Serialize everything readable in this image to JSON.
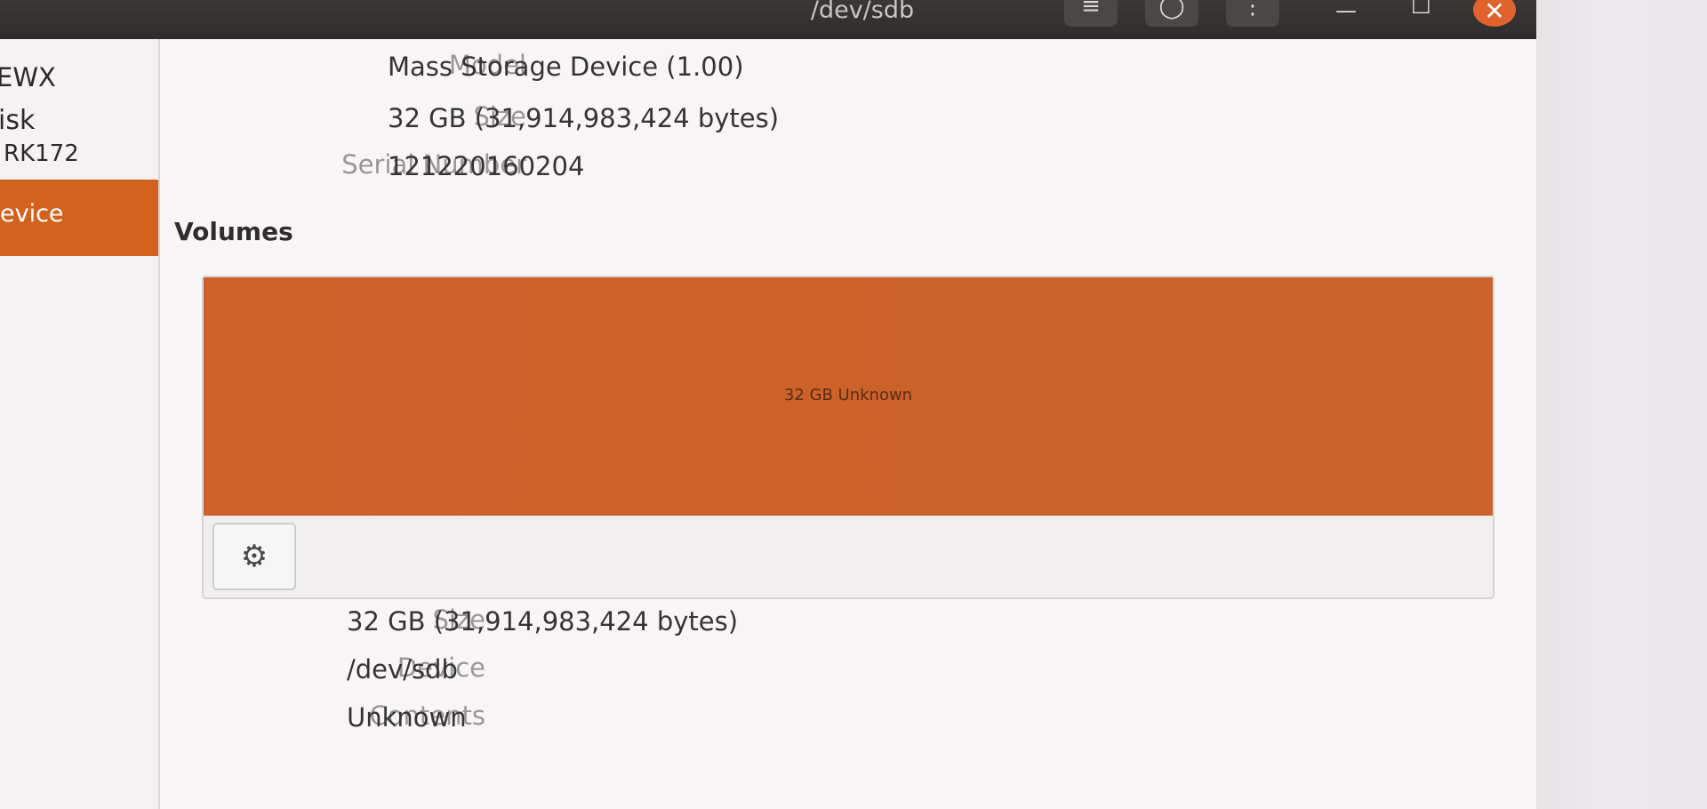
{
  "window": {
    "title": "/dev/sdb"
  },
  "header": {
    "menu_icon": "hamburger-icon",
    "power_icon": "power-icon",
    "more_icon": "vertical-ellipsis-icon"
  },
  "sidebar": {
    "partial_items": [
      "EWX",
      "isk",
      "RK172"
    ],
    "selected_label": "evice"
  },
  "drive": {
    "model_label": "Model",
    "model_value": "Mass Storage Device (1.00)",
    "size_label": "Size",
    "size_value": "32 GB (31,914,983,424 bytes)",
    "serial_label": "Serial Number",
    "serial_value": "121220160204"
  },
  "volumes": {
    "title": "Volumes",
    "segment_label": "32 GB Unknown",
    "accent_color": "#d3621f",
    "gear_icon": "gears-icon"
  },
  "partition": {
    "size_label": "Size",
    "size_value": "32 GB (31,914,983,424 bytes)",
    "device_label": "Device",
    "device_value": "/dev/sdb",
    "contents_label": "Contents",
    "contents_value": "Unknown"
  }
}
